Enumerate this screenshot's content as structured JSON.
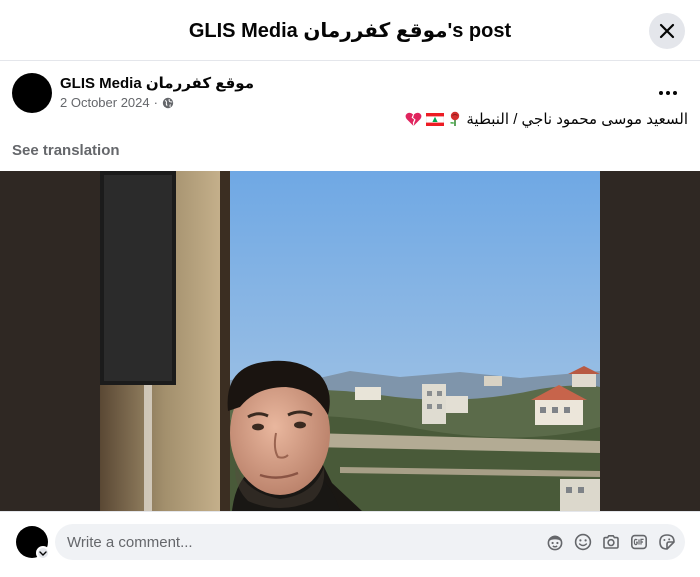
{
  "dialog": {
    "title": "GLIS Media موقع كفررمان's post"
  },
  "post": {
    "page_name": "GLIS Media موقع كفررمان",
    "date": "2 October 2024",
    "separator": "·",
    "privacy_icon": "globe-icon",
    "text": "السعيد موسى محمود ناجي / النبطية",
    "emoji": [
      "rose",
      "lebanon-flag",
      "broken-heart"
    ],
    "see_translation": "See translation",
    "photo_description": "man-selfie-balcony-view"
  },
  "composer": {
    "placeholder": "Write a comment...",
    "tools": [
      "avatar-sticker-icon",
      "emoji-icon",
      "camera-icon",
      "gif-icon",
      "sticker-icon"
    ]
  },
  "colors": {
    "secondary_text": "#65676b",
    "divider": "#e4e6eb",
    "input_bg": "#f0f2f5",
    "photo_letterbox": "#2f2823"
  }
}
